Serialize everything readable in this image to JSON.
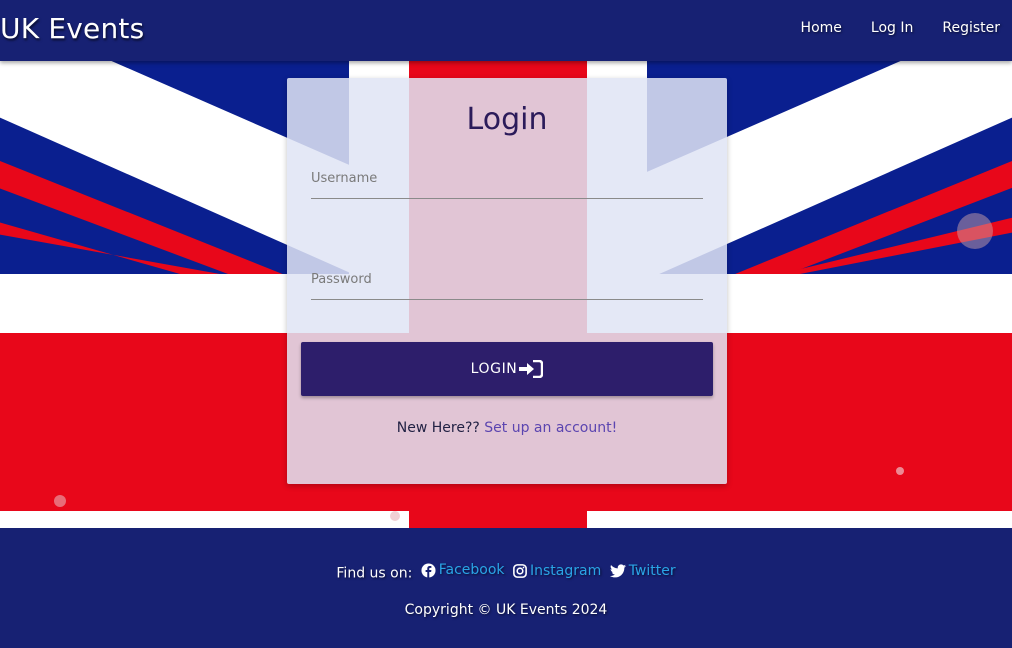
{
  "navbar": {
    "brand": "UK Events",
    "links": [
      "Home",
      "Log In",
      "Register"
    ]
  },
  "login": {
    "title": "Login",
    "username_placeholder": "Username",
    "password_placeholder": "Password",
    "button_label": "LOGIN",
    "button_icon": "sign-in-icon",
    "prompt": "New Here??",
    "signup_link": "Set up an account!"
  },
  "footer": {
    "find_us": "Find us on:",
    "social": [
      {
        "label": "Facebook",
        "icon": "facebook-icon"
      },
      {
        "label": "Instagram",
        "icon": "instagram-icon"
      },
      {
        "label": "Twitter",
        "icon": "twitter-icon"
      }
    ],
    "copyright": "Copyright © UK Events 2024"
  },
  "colors": {
    "navbar": "#172173",
    "button": "#2d1e6b",
    "link": "#5b45b0",
    "social_link": "#2aa4e6",
    "flag_red": "#e8071a",
    "flag_blue": "#0a1f8f"
  }
}
